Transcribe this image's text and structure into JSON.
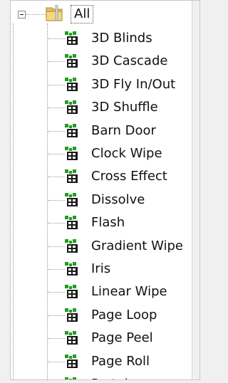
{
  "tree": {
    "root": {
      "label": "All",
      "expanded": true
    },
    "items": [
      {
        "label": "3D Blinds"
      },
      {
        "label": "3D Cascade"
      },
      {
        "label": "3D Fly In/Out"
      },
      {
        "label": "3D Shuffle"
      },
      {
        "label": "Barn Door"
      },
      {
        "label": "Clock Wipe"
      },
      {
        "label": "Cross Effect"
      },
      {
        "label": "Dissolve"
      },
      {
        "label": "Flash"
      },
      {
        "label": "Gradient Wipe"
      },
      {
        "label": "Iris"
      },
      {
        "label": "Linear Wipe"
      },
      {
        "label": "Page Loop"
      },
      {
        "label": "Page Peel"
      },
      {
        "label": "Page Roll"
      },
      {
        "label": "Portals"
      }
    ],
    "icons": {
      "root": "folder-icon",
      "item": "transition-effect-icon"
    },
    "colors": {
      "icon_green": "#1f9e1f",
      "icon_dark": "#1a1a1a",
      "folder": "#e8c15a"
    }
  }
}
